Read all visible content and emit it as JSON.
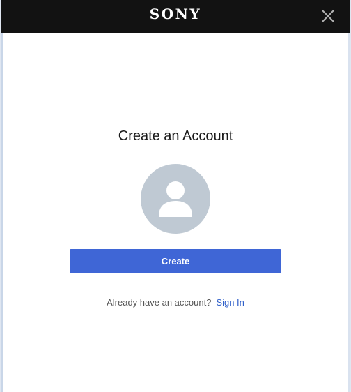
{
  "header": {
    "brand": "SONY",
    "close_icon": "close-icon"
  },
  "main": {
    "title": "Create an Account",
    "avatar_icon": "user-silhouette-icon",
    "create_button_label": "Create",
    "signin_prompt": "Already have an account?",
    "signin_link": "Sign In"
  },
  "colors": {
    "header_bg": "#121212",
    "accent": "#3f66d6",
    "link": "#2f5fc9",
    "avatar_bg": "#bfc9d3"
  }
}
